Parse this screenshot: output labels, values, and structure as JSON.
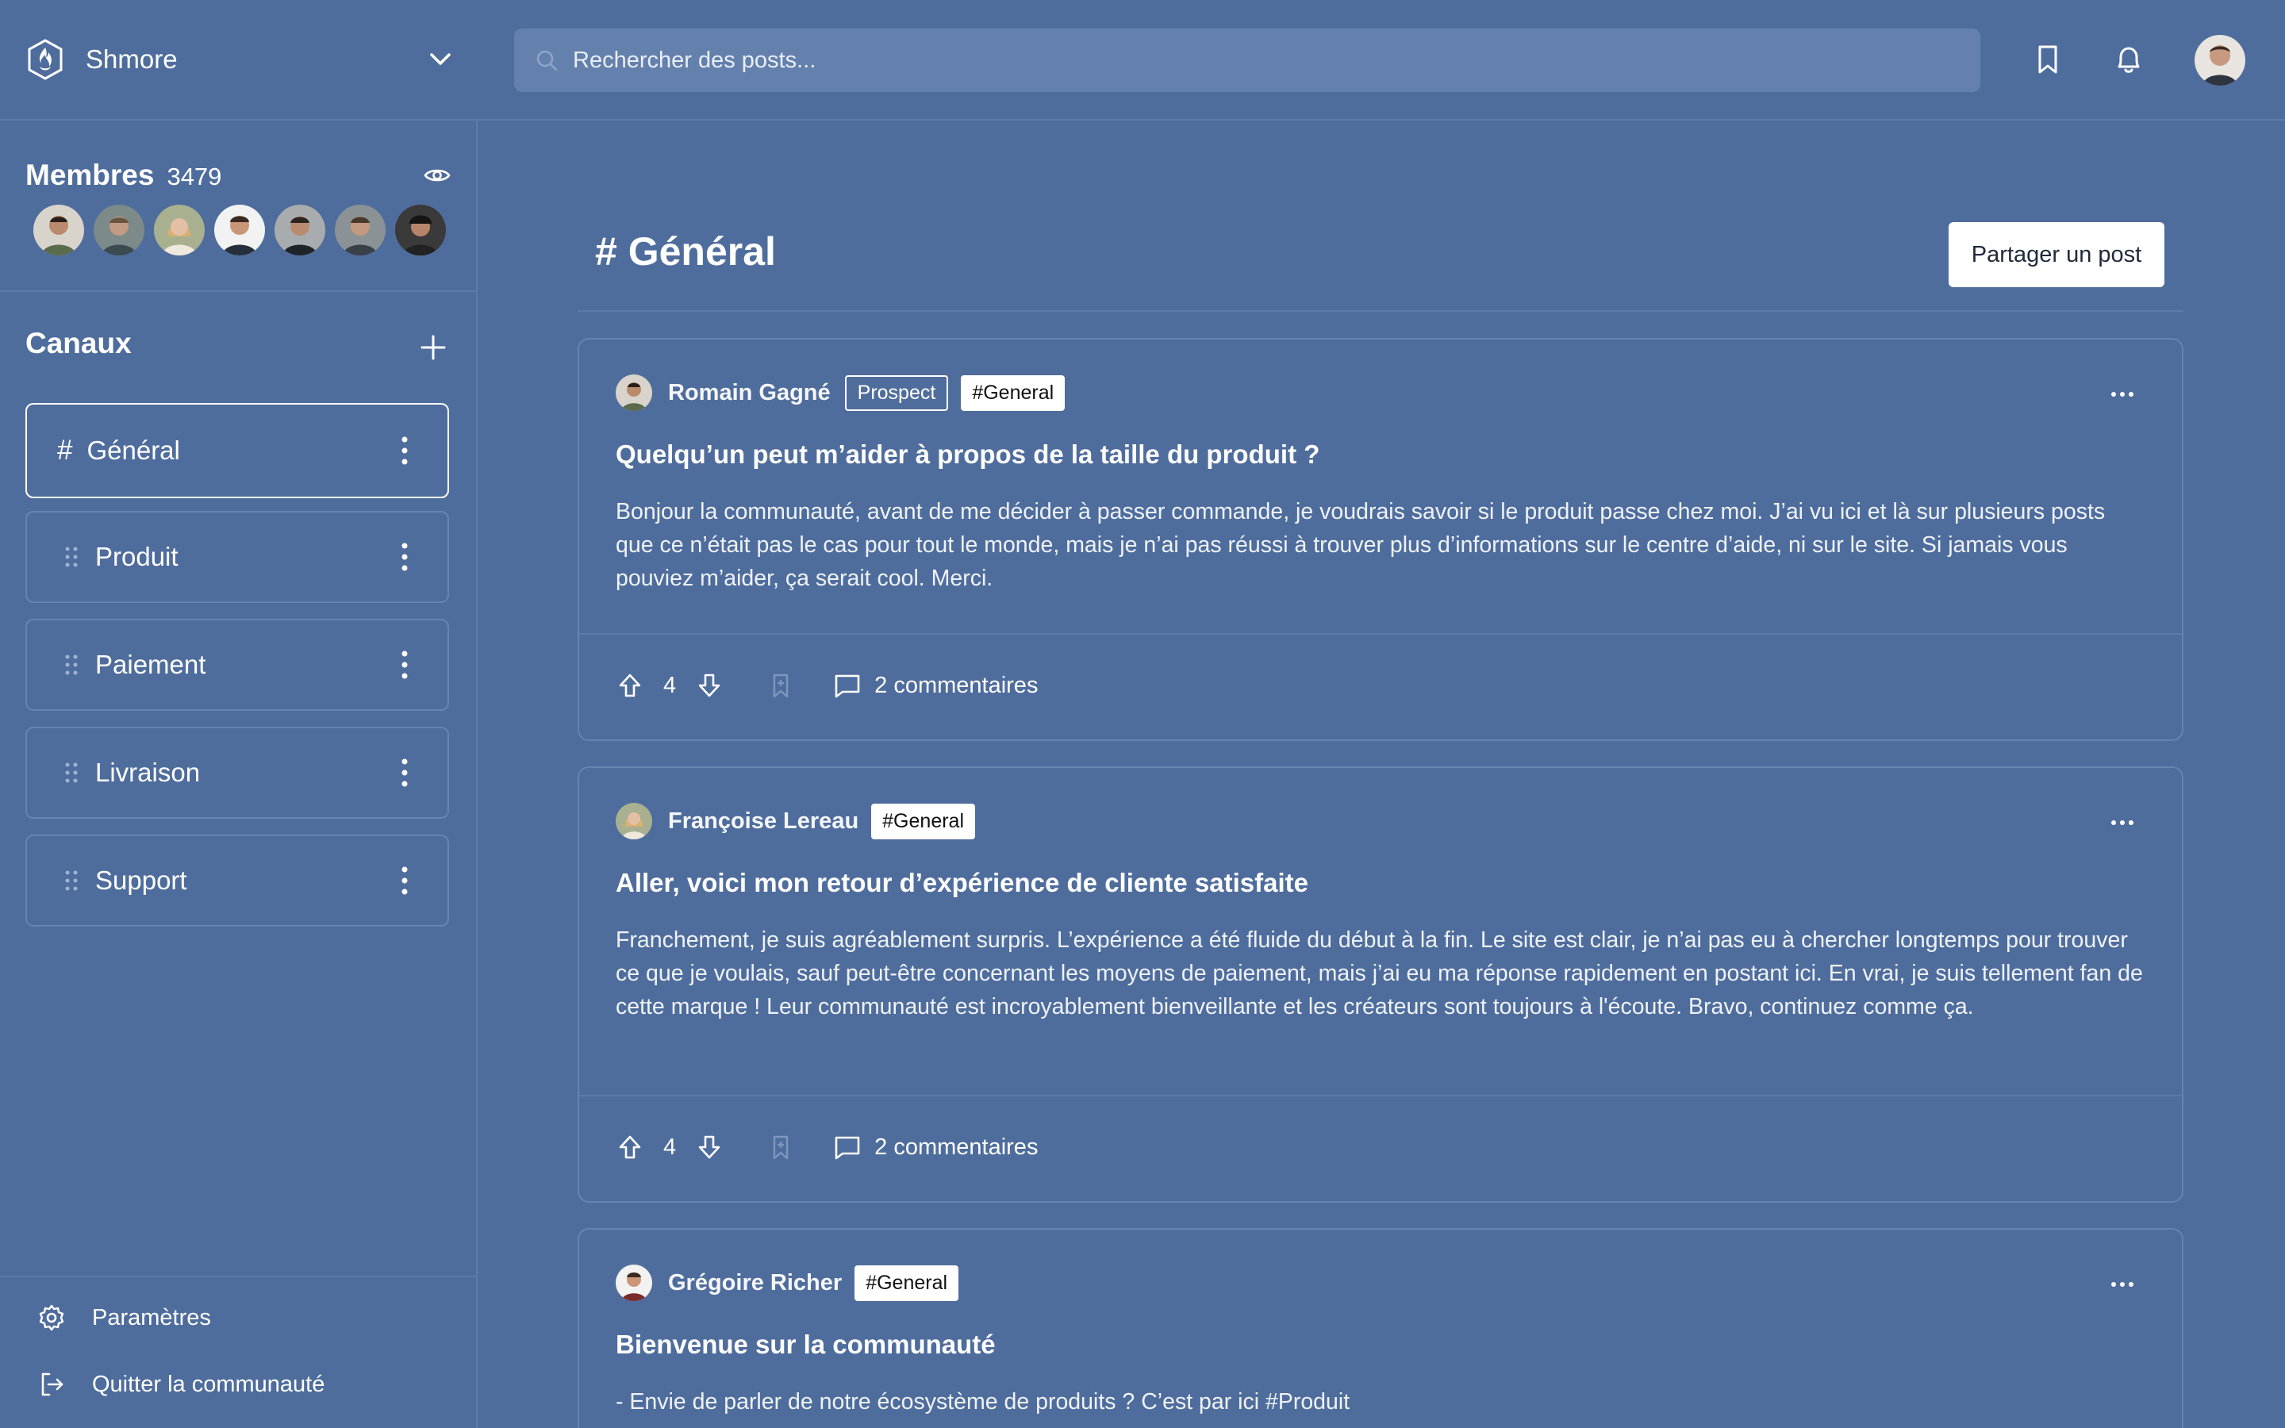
{
  "app": {
    "name": "Shmore"
  },
  "search": {
    "placeholder": "Rechercher des posts..."
  },
  "sidebar": {
    "members_label": "Membres",
    "members_count": "3479",
    "channels_title": "Canaux",
    "channels": [
      {
        "label": "Général",
        "active": true
      },
      {
        "label": "Produit"
      },
      {
        "label": "Paiement"
      },
      {
        "label": "Livraison"
      },
      {
        "label": "Support"
      }
    ],
    "settings_label": "Paramètres",
    "leave_label": "Quitter la communauté"
  },
  "main": {
    "hash": "#",
    "title": "Général",
    "share_label": "Partager un post"
  },
  "posts": [
    {
      "author": "Romain Gagné",
      "role": "Prospect",
      "tag": "#General",
      "title": "Quelqu’un peut m’aider à propos de la taille du produit ?",
      "body": "Bonjour la communauté, avant de me décider à passer commande, je voudrais savoir si le produit passe chez moi. J’ai vu ici et là sur plusieurs posts que ce n’était pas le cas pour tout le monde, mais je n’ai pas réussi à trouver plus d’informations sur le centre d’aide, ni sur le site. Si jamais vous pouviez m’aider, ça serait cool. Merci.",
      "votes": "4",
      "comments": "2 commentaires"
    },
    {
      "author": "Françoise Lereau",
      "tag": "#General",
      "title": "Aller, voici mon retour d’expérience de cliente satisfaite",
      "body": "Franchement, je suis agréablement surpris. L’expérience a été fluide du début à la fin. Le site est clair, je n’ai pas eu à chercher longtemps pour trouver ce que je voulais, sauf peut-être concernant les moyens de paiement, mais j’ai eu ma réponse rapidement en postant ici. En vrai, je suis tellement fan de cette marque ! Leur communauté est incroyablement bienveillante et les créateurs sont toujours à l'écoute. Bravo, continuez comme ça.",
      "votes": "4",
      "comments": "2 commentaires"
    },
    {
      "author": "Grégoire Richer",
      "tag": "#General",
      "title": "Bienvenue sur la communauté",
      "body": "- Envie de parler de notre écosystème de produits ? C’est par ici #Produit"
    }
  ]
}
